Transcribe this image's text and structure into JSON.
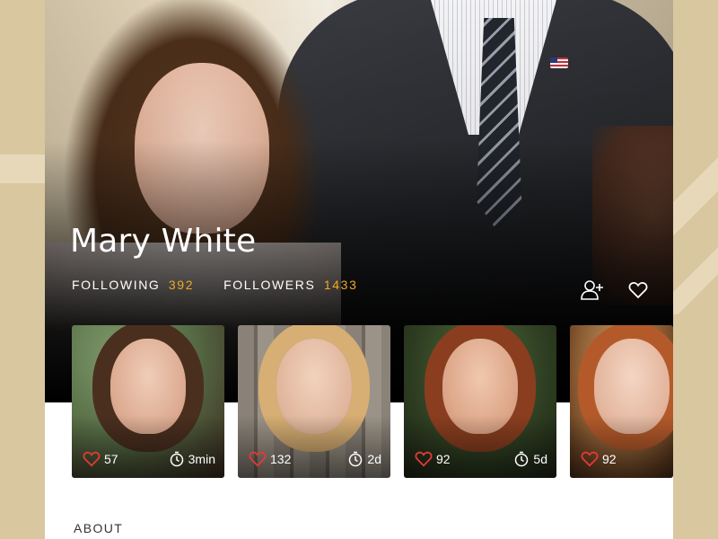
{
  "profile": {
    "name": "Mary White",
    "following_label": "FOLLOWING",
    "following_count": "392",
    "followers_label": "FOLLOWERS",
    "followers_count": "1433"
  },
  "actions": {
    "follow_icon": "add-user-icon",
    "like_icon": "heart-outline-icon"
  },
  "cards": [
    {
      "likes": "57",
      "time": "3min"
    },
    {
      "likes": "132",
      "time": "2d"
    },
    {
      "likes": "92",
      "time": "5d"
    },
    {
      "likes": "92"
    }
  ],
  "about": {
    "title": "ABOUT"
  },
  "colors": {
    "accent": "#f1a91e",
    "like_red": "#e53935",
    "background": "#d9c7a0"
  }
}
